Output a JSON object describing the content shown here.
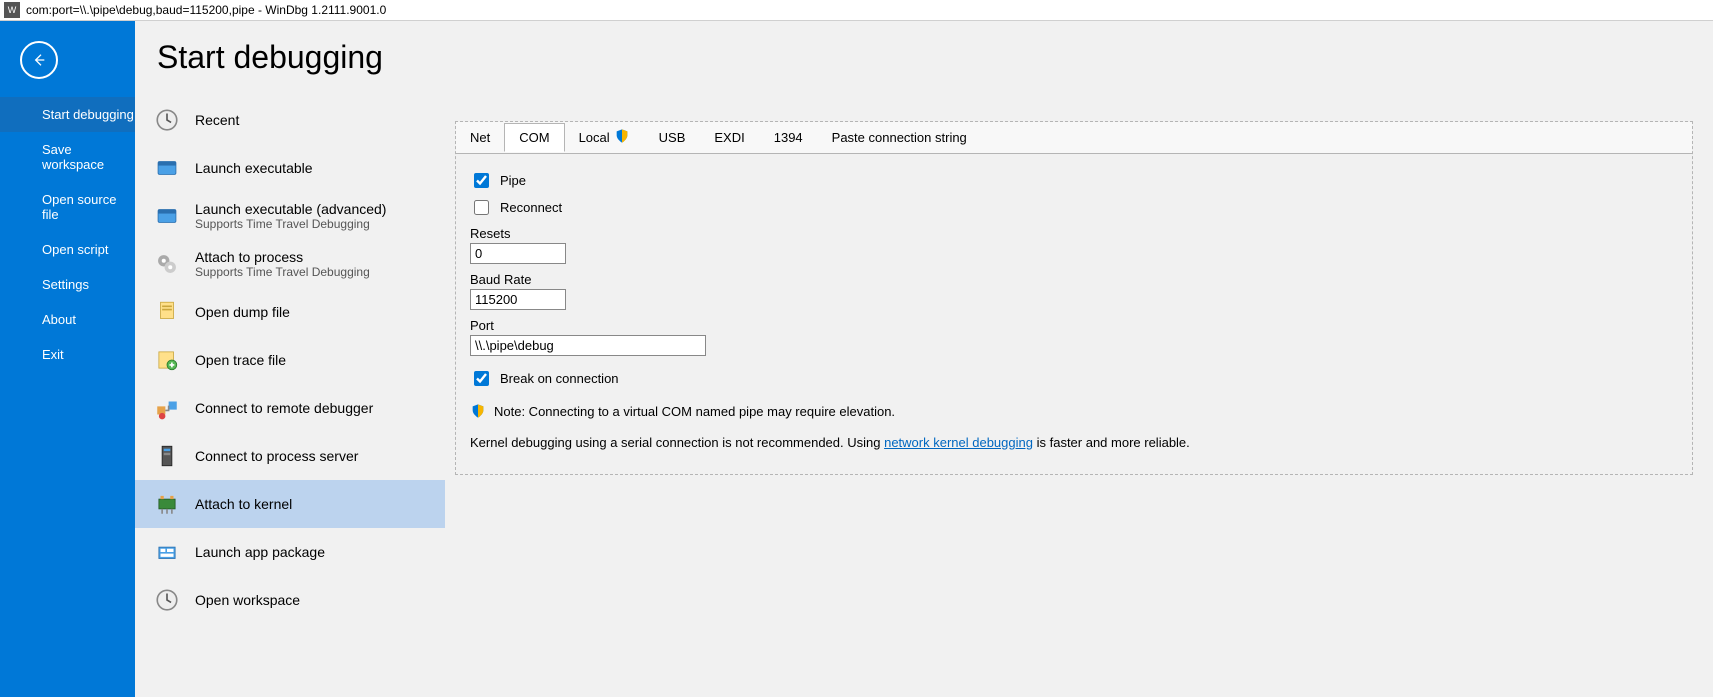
{
  "window": {
    "title": "com:port=\\\\.\\pipe\\debug,baud=115200,pipe - WinDbg 1.2111.9001.0",
    "app_icon_label": "W"
  },
  "sidebar": {
    "items": [
      {
        "label": "Start debugging",
        "selected": true
      },
      {
        "label": "Save workspace",
        "selected": false
      },
      {
        "label": "Open source file",
        "selected": false
      },
      {
        "label": "Open script",
        "selected": false
      },
      {
        "label": "Settings",
        "selected": false
      },
      {
        "label": "About",
        "selected": false
      },
      {
        "label": "Exit",
        "selected": false
      }
    ]
  },
  "page": {
    "title": "Start debugging"
  },
  "options": [
    {
      "icon": "clock",
      "label": "Recent"
    },
    {
      "icon": "exe",
      "label": "Launch executable"
    },
    {
      "icon": "exe2",
      "label": "Launch executable (advanced)",
      "sub": "Supports Time Travel Debugging"
    },
    {
      "icon": "gear",
      "label": "Attach to process",
      "sub": "Supports Time Travel Debugging"
    },
    {
      "icon": "dump",
      "label": "Open dump file"
    },
    {
      "icon": "trace",
      "label": "Open trace file"
    },
    {
      "icon": "remote",
      "label": "Connect to remote debugger"
    },
    {
      "icon": "server",
      "label": "Connect to process server"
    },
    {
      "icon": "kernel",
      "label": "Attach to kernel",
      "selected": true
    },
    {
      "icon": "package",
      "label": "Launch app package"
    },
    {
      "icon": "clock",
      "label": "Open workspace"
    }
  ],
  "tabs": [
    {
      "label": "Net"
    },
    {
      "label": "COM",
      "active": true
    },
    {
      "label": "Local",
      "shield": true
    },
    {
      "label": "USB"
    },
    {
      "label": "EXDI"
    },
    {
      "label": "1394"
    },
    {
      "label": "Paste connection string"
    }
  ],
  "form": {
    "pipe": {
      "label": "Pipe",
      "checked": true
    },
    "reconnect": {
      "label": "Reconnect",
      "checked": false
    },
    "resets": {
      "label": "Resets",
      "value": "0"
    },
    "baud": {
      "label": "Baud Rate",
      "value": "115200"
    },
    "port": {
      "label": "Port",
      "value": "\\\\.\\pipe\\debug"
    },
    "break": {
      "label": "Break on connection",
      "checked": true
    },
    "note": "Note: Connecting to a virtual COM named pipe may require elevation.",
    "info_pre": "Kernel debugging using a serial connection is not recommended. Using ",
    "info_link": "network kernel debugging",
    "info_post": " is faster and more reliable."
  }
}
